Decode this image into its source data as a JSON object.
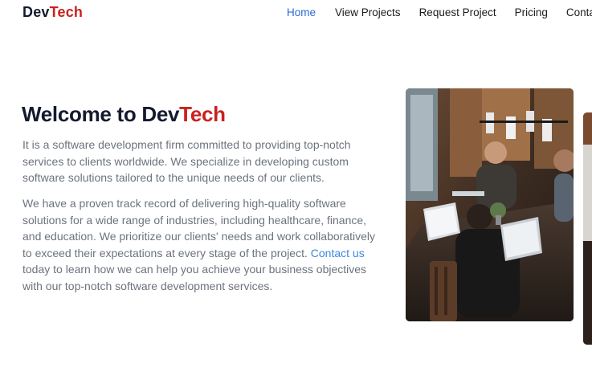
{
  "header": {
    "logo_part1": "Dev",
    "logo_part2": "Tech",
    "nav": [
      {
        "label": "Home"
      },
      {
        "label": "View Projects"
      },
      {
        "label": "Request Project"
      },
      {
        "label": "Pricing"
      },
      {
        "label": "Contact"
      }
    ]
  },
  "hero": {
    "title_prefix": "Welcome to ",
    "title_part1": "Dev",
    "title_part2": "Tech",
    "para1": "It is a software development firm committed to providing top-notch services to clients worldwide. We specialize in developing custom software solutions tailored to the unique needs of our clients.",
    "para2_before": "We have a proven track record of delivering high-quality software solutions for a wide range of industries, including healthcare, finance, and education. We prioritize our clients' needs and work collaboratively to exceed their expectations at every stage of the project. ",
    "para2_link": "Contact us",
    "para2_after": " today to learn how we can help you achieve your business objectives with our top-notch software development services."
  },
  "colors": {
    "brand_dark": "#141a2e",
    "brand_red": "#c8221f",
    "link_blue": "#2b6bd6",
    "body_text": "#6c737d"
  }
}
